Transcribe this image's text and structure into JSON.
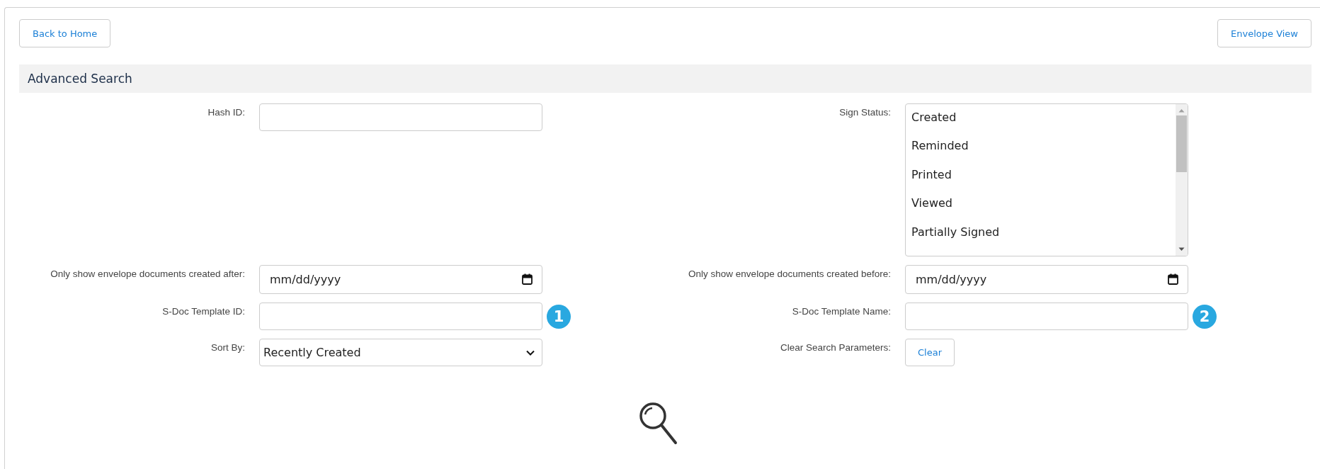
{
  "top_buttons": [
    {
      "label": "Back to Home"
    },
    {
      "label": "Envelope View"
    }
  ],
  "section": {
    "title": "Advanced Search"
  },
  "fields": [
    {
      "kind": "text",
      "label": "Hash ID:"
    },
    {
      "kind": "listbox",
      "label": "Sign Status:",
      "options": [
        "Created",
        "Reminded",
        "Printed",
        "Viewed",
        "Partially Signed"
      ]
    },
    {
      "kind": "date",
      "label": "Only show envelope documents created after:",
      "placeholder": "mm/dd/yyyy"
    },
    {
      "kind": "date",
      "label": "Only show envelope documents created before:",
      "placeholder": "mm/dd/yyyy"
    },
    {
      "kind": "text",
      "label": "S-Doc Template ID:",
      "badge": "1"
    },
    {
      "kind": "text",
      "label": "S-Doc Template Name:",
      "badge": "2"
    },
    {
      "kind": "select",
      "label": "Sort By:",
      "value": "Recently Created"
    },
    {
      "kind": "button",
      "label": "Clear Search Parameters:",
      "button": "Clear"
    }
  ]
}
